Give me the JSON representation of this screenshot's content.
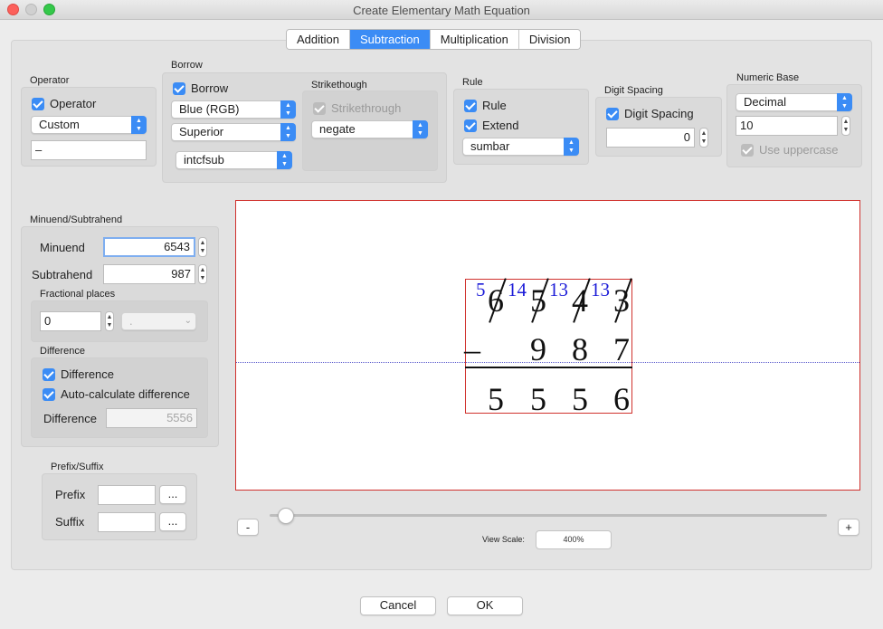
{
  "window": {
    "title": "Create Elementary Math Equation"
  },
  "tabs": [
    "Addition",
    "Subtraction",
    "Multiplication",
    "Division"
  ],
  "operator": {
    "group_label": "Operator",
    "checkbox_label": "Operator",
    "popup_value": "Custom",
    "symbol_value": "–"
  },
  "borrow": {
    "group_label": "Borrow",
    "checkbox_label": "Borrow",
    "color_value": "Blue (RGB)",
    "position_value": "Superior",
    "command_value": "intcfsub"
  },
  "strikethrough": {
    "group_label": "Strikethough",
    "checkbox_label": "Strikethrough",
    "popup_value": "negate"
  },
  "rule": {
    "group_label": "Rule",
    "rule_label": "Rule",
    "extend_label": "Extend",
    "popup_value": "sumbar"
  },
  "digit_spacing": {
    "group_label": "Digit Spacing",
    "checkbox_label": "Digit Spacing",
    "value": "0"
  },
  "numeric_base": {
    "group_label": "Numeric Base",
    "popup_value": "Decimal",
    "value": "10",
    "uppercase_label": "Use uppercase"
  },
  "minuend_subtrahend": {
    "group_label": "Minuend/Subtrahend",
    "minuend_label": "Minuend",
    "minuend_value": "6543",
    "subtrahend_label": "Subtrahend",
    "subtrahend_value": "987",
    "fractional_label": "Fractional places",
    "fractional_value": "0",
    "separator_value": "."
  },
  "difference": {
    "group_label": "Difference",
    "checkbox_label": "Difference",
    "auto_label": "Auto-calculate difference",
    "field_label": "Difference",
    "value": "5556"
  },
  "prefix_suffix": {
    "group_label": "Prefix/Suffix",
    "prefix_label": "Prefix",
    "suffix_label": "Suffix",
    "ellipsis": "..."
  },
  "equation": {
    "minuend_digits": [
      "6",
      "5",
      "4",
      "3"
    ],
    "borrow_marks": [
      "5",
      "14",
      "13",
      "13"
    ],
    "operator_symbol": "–",
    "subtrahend_digits": [
      "9",
      "8",
      "7"
    ],
    "result_digits": [
      "5",
      "5",
      "5",
      "6"
    ]
  },
  "view": {
    "minus_label": "-",
    "plus_label": "+",
    "scale_label": "View Scale:",
    "scale_value": "400%",
    "scale_fraction": 0.03
  },
  "footer": {
    "cancel_label": "Cancel",
    "ok_label": "OK"
  },
  "colors": {
    "accent": "#3b8cf5",
    "borrow_blue": "#1c1cd8",
    "frame_red": "#d0312d"
  }
}
